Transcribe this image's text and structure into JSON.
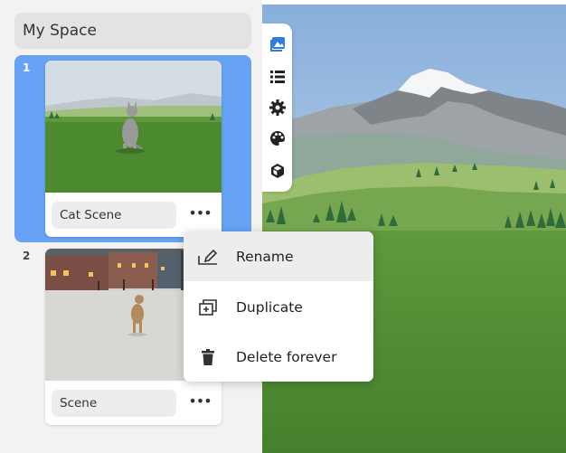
{
  "space": {
    "title": "My Space"
  },
  "scenes": [
    {
      "number": "1",
      "name": "Cat Scene",
      "selected": true
    },
    {
      "number": "2",
      "name": "Scene",
      "selected": false
    }
  ],
  "more_button_label": "•••",
  "toolbar": {
    "tools": [
      {
        "icon": "image-gallery-icon",
        "active": true
      },
      {
        "icon": "list-icon"
      },
      {
        "icon": "gear-icon"
      },
      {
        "icon": "palette-icon"
      },
      {
        "icon": "cube-icon"
      }
    ]
  },
  "context_menu": {
    "items": [
      {
        "label": "Rename",
        "icon": "rename-icon",
        "hovered": true
      },
      {
        "label": "Duplicate",
        "icon": "duplicate-icon"
      },
      {
        "label": "Delete forever",
        "icon": "trash-icon"
      }
    ]
  },
  "colors": {
    "selected_accent": "#66a3f4",
    "toolbar_active": "#2f7de1",
    "sky_top": "#88b1dc",
    "grass": "#4d8a33"
  }
}
